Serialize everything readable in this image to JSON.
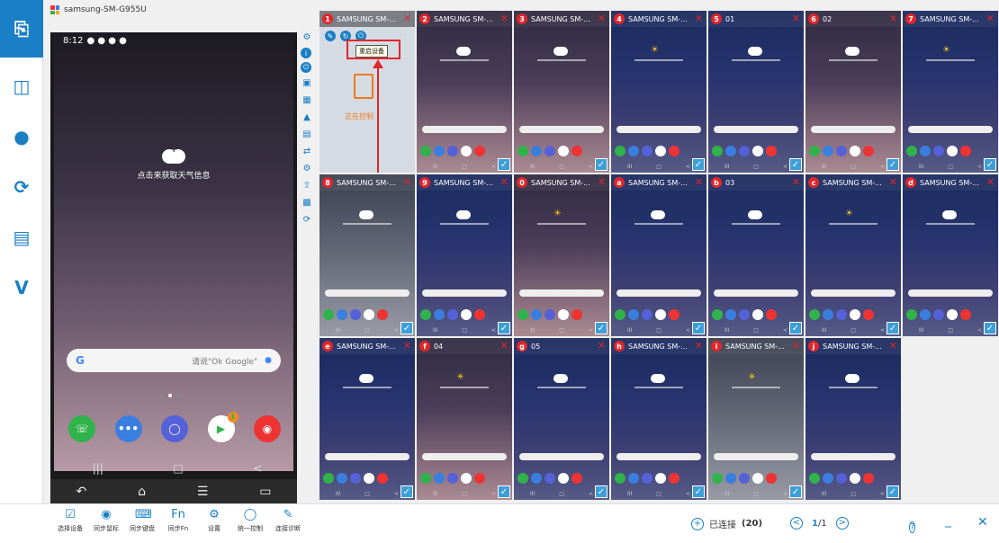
{
  "window": {
    "device_title": "samsung-SM-G955U"
  },
  "nav": {
    "items": [
      {
        "id": "devices",
        "icon": "phone-screen-icon"
      },
      {
        "id": "screen-cast",
        "icon": "cast-icon"
      },
      {
        "id": "chat",
        "icon": "chat-icon"
      },
      {
        "id": "sync",
        "icon": "sync-icon"
      },
      {
        "id": "files",
        "icon": "file-transfer-icon"
      },
      {
        "id": "vip",
        "icon": "v-logo-icon"
      }
    ]
  },
  "phone": {
    "status_time": "8:12",
    "weather_text": "点击来获取天气信息",
    "search_hint": "请说\"Ok Google\"",
    "play_badge": "1"
  },
  "selected_cell": {
    "tooltip": "重启设备",
    "controlling_text": "正在控制"
  },
  "cells": [
    {
      "num": "1",
      "name": "SAMSUNG SM-...",
      "style": "sel"
    },
    {
      "num": "2",
      "name": "SAMSUNG SM-...",
      "style": "warm"
    },
    {
      "num": "3",
      "name": "SAMSUNG SM-...",
      "style": "warm"
    },
    {
      "num": "4",
      "name": "SAMSUNG SM-...",
      "style": "blue"
    },
    {
      "num": "5",
      "name": "01",
      "style": "blue"
    },
    {
      "num": "6",
      "name": "02",
      "style": "warm"
    },
    {
      "num": "7",
      "name": "SAMSUNG SM-...",
      "style": "blue"
    },
    {
      "num": "8",
      "name": "SAMSUNG SM-...",
      "style": "gray"
    },
    {
      "num": "9",
      "name": "SAMSUNG SM-...",
      "style": "blue"
    },
    {
      "num": "0",
      "name": "SAMSUNG SM-...",
      "style": "warm"
    },
    {
      "num": "a",
      "name": "SAMSUNG SM-...",
      "style": "blue"
    },
    {
      "num": "b",
      "name": "03",
      "style": "blue"
    },
    {
      "num": "c",
      "name": "SAMSUNG SM-...",
      "style": "blue"
    },
    {
      "num": "d",
      "name": "SAMSUNG SM-...",
      "style": "blue"
    },
    {
      "num": "e",
      "name": "SAMSUNG SM-...",
      "style": "blue"
    },
    {
      "num": "f",
      "name": "04",
      "style": "warm"
    },
    {
      "num": "g",
      "name": "05",
      "style": "blue"
    },
    {
      "num": "h",
      "name": "SAMSUNG SM-...",
      "style": "blue"
    },
    {
      "num": "i",
      "name": "SAMSUNG SM-...",
      "style": "gray"
    },
    {
      "num": "j",
      "name": "SAMSUNG SM-...",
      "style": "blue"
    }
  ],
  "bottom": {
    "tools": [
      {
        "label": "选择设备",
        "icon": "select-device-icon"
      },
      {
        "label": "同步鼠标",
        "icon": "sync-mouse-icon"
      },
      {
        "label": "同步键盘",
        "icon": "sync-keyboard-icon"
      },
      {
        "label": "同步Fn",
        "icon": "sync-fn-icon"
      },
      {
        "label": "设置",
        "icon": "settings-icon"
      },
      {
        "label": "统一控制",
        "icon": "unified-control-icon"
      },
      {
        "label": "连接诊断",
        "icon": "diagnose-icon"
      }
    ],
    "connected_label": "已连接",
    "connected_count": "(20)",
    "page_current": "1",
    "page_total": "/1"
  },
  "colors": {
    "accent": "#1a7fc4",
    "badge_red": "#e0262a",
    "controlling_orange": "#f07a1a"
  }
}
